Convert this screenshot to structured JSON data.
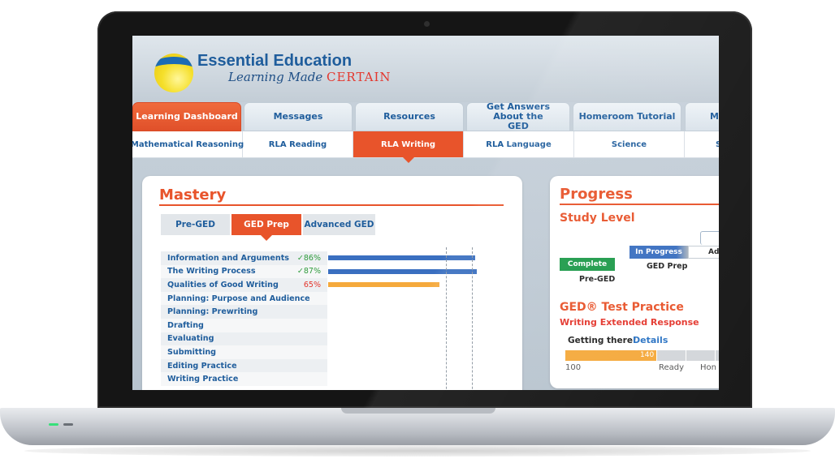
{
  "brand": {
    "title": "Essential Education",
    "tagline_pre": "Learning Made ",
    "tagline_accent": "CERTAIN",
    "accent_color": "#e8542b",
    "link_color": "#1f5d9c"
  },
  "main_tabs": [
    {
      "label": "Learning Dashboard",
      "active": true
    },
    {
      "label": "Messages",
      "active": false
    },
    {
      "label": "Resources",
      "active": false
    },
    {
      "label": "Get Answers About the GED",
      "active": false
    },
    {
      "label": "Homeroom Tutorial",
      "active": false
    },
    {
      "label": "M",
      "active": false
    }
  ],
  "subjects": [
    {
      "label": "Mathematical Reasoning",
      "active": false
    },
    {
      "label": "RLA Reading",
      "active": false
    },
    {
      "label": "RLA Writing",
      "active": true
    },
    {
      "label": "RLA Language",
      "active": false
    },
    {
      "label": "Science",
      "active": false
    },
    {
      "label": "S",
      "active": false
    }
  ],
  "mastery": {
    "title": "Mastery",
    "levels": [
      {
        "label": "Pre-GED",
        "active": false
      },
      {
        "label": "GED Prep",
        "active": true
      },
      {
        "label": "Advanced GED",
        "active": false
      }
    ],
    "skills": [
      {
        "label": "Information and Arguments",
        "percent_text": "✓86%",
        "status": "green",
        "value": 86,
        "bar_color": "#3a6fc0"
      },
      {
        "label": "The Writing Process",
        "percent_text": "✓87%",
        "status": "green",
        "value": 87,
        "bar_color": "#3a6fc0"
      },
      {
        "label": "Qualities of Good Writing",
        "percent_text": "65%",
        "status": "red",
        "value": 65,
        "bar_color": "#f5a93c"
      },
      {
        "label": "Planning: Purpose and Audience",
        "percent_text": "",
        "status": "",
        "value": null
      },
      {
        "label": "Planning: Prewriting",
        "percent_text": "",
        "status": "",
        "value": null
      },
      {
        "label": "Drafting",
        "percent_text": "",
        "status": "",
        "value": null
      },
      {
        "label": "Evaluating",
        "percent_text": "",
        "status": "",
        "value": null
      },
      {
        "label": "Submitting",
        "percent_text": "",
        "status": "",
        "value": null
      },
      {
        "label": "Editing Practice",
        "percent_text": "",
        "status": "",
        "value": null
      },
      {
        "label": "Writing Practice",
        "percent_text": "",
        "status": "",
        "value": null
      }
    ]
  },
  "progress": {
    "title": "Progress",
    "study_level_title": "Study Level",
    "steps": [
      {
        "badge": "Complete",
        "label": "Pre-GED",
        "color": "#1e9a4a"
      },
      {
        "badge": "In Progress",
        "label": "GED Prep",
        "color": "#3a6fc0"
      },
      {
        "badge": "",
        "label": "Ad",
        "color": "#ffffff"
      }
    ],
    "test_practice_title": "GED® Test Practice",
    "test_practice_subtitle": "Writing Extended Response",
    "status_text": "Getting there!",
    "details_link": "Details",
    "score": "140",
    "scale_labels": [
      "100",
      "Ready",
      "Hon"
    ]
  }
}
